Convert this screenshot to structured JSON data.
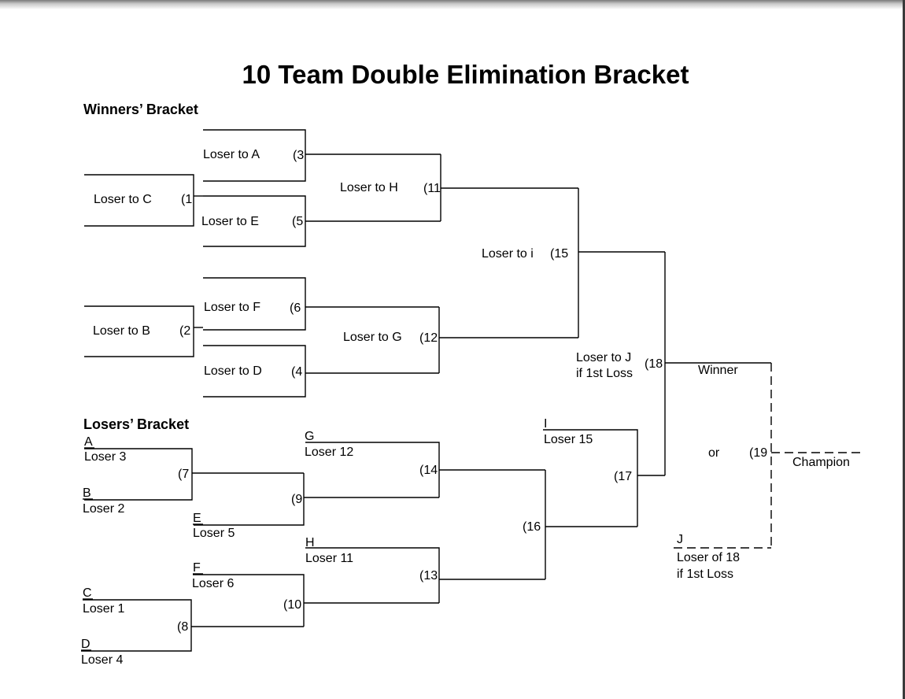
{
  "title": "10 Team Double Elimination Bracket",
  "winners_heading": "Winners’ Bracket",
  "losers_heading": "Losers’ Bracket",
  "games": {
    "g1": "(1",
    "g2": "(2",
    "g3": "(3",
    "g4": "(4",
    "g5": "(5",
    "g6": "(6",
    "g7": "(7",
    "g8": "(8",
    "g9": "(9",
    "g10": "(10",
    "g11": "(11",
    "g12": "(12",
    "g13": "(13",
    "g14": "(14",
    "g15": "(15",
    "g16": "(16",
    "g17": "(17",
    "g18": "(18",
    "g19": "(19"
  },
  "winners_labels": {
    "c": "Loser to C",
    "b": "Loser to B",
    "a": "Loser to A",
    "e": "Loser to E",
    "f": "Loser to F",
    "d": "Loser to D",
    "h": "Loser to H",
    "g": "Loser to G",
    "i": "Loser to i",
    "j": "Loser to J",
    "j_note": "if 1st Loss"
  },
  "losers_slots": {
    "a_letter": "A",
    "a_text": "Loser 3",
    "b_letter": "B",
    "b_text": "Loser 2",
    "e_letter": "E",
    "e_text": "Loser 5",
    "c_letter": "C",
    "c_text": "Loser 1",
    "d_letter": "D",
    "d_text": "Loser 4",
    "f_letter": "F",
    "f_text": "Loser 6",
    "g_letter": "G",
    "g_text": "Loser 12",
    "h_letter": "H",
    "h_text": "Loser 11",
    "i_letter": "I",
    "i_text": "Loser 15"
  },
  "final": {
    "winner": "Winner",
    "or": "or",
    "champion": "Champion",
    "j_letter": "J",
    "j_text": "Loser of 18",
    "j_note": "if 1st Loss"
  }
}
